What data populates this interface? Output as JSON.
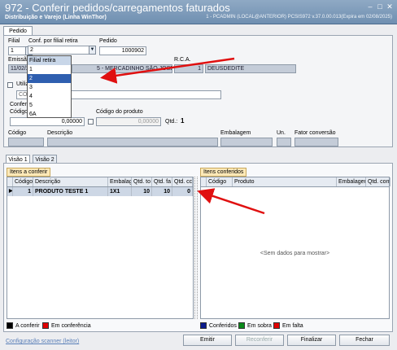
{
  "window": {
    "title": "972 - Conferir pedidos/carregamentos faturados",
    "subtitle": "Distribuição e Varejo (Linha WinThor)",
    "version": "1 - PCADMIN (LOCAL@ANTERIOR)   PCSIS972  v.37.0.00.013(Expira em 02/08/2025)"
  },
  "main_tab": "Pedido",
  "filial": {
    "label": "Filial",
    "value": "1"
  },
  "conf_filial": {
    "label": "Conf. por filial retira",
    "value": "2"
  },
  "pedido": {
    "label": "Pedido",
    "value": "1000902"
  },
  "emissao": {
    "label": "Emissão",
    "value": "11/02/2025"
  },
  "cliente": {
    "value": "5 - MERCADINHO SÃO JOSÉ"
  },
  "rca": {
    "label": "R.C.A.",
    "code": "1",
    "name": "DEUSDEDITE"
  },
  "utiliza": {
    "label": "Utiliza em"
  },
  "codigo_placeholder": "CÓDIGO",
  "conferencia": {
    "label": "Conferência"
  },
  "codigo_b": {
    "label": "Código de b",
    "value": "0,00000"
  },
  "codigo_produto": {
    "label": "Código do produto",
    "value": "0,00000"
  },
  "qtd": {
    "label": "Qtd.:",
    "value": "1"
  },
  "product_headers": {
    "codigo": "Código",
    "descricao": "Descrição",
    "embalagem": "Embalagem",
    "un": "Un.",
    "fator": "Fator conversão"
  },
  "dropdown": {
    "header": "Filial retira",
    "options": [
      "1",
      "2",
      "3",
      "4",
      "5",
      "6A"
    ],
    "selected": "2"
  },
  "visao_tabs": [
    "Visão 1",
    "Visão 2"
  ],
  "itens_conferir": {
    "title": "Itens a conferir",
    "columns": [
      "Código",
      "Descrição",
      "Embalage",
      "Qtd. to",
      "Qtd. fa",
      "Qtd. cc"
    ],
    "rows": [
      {
        "codigo": "1",
        "descricao": "PRODUTO TESTE 1",
        "embalagem": "1X1",
        "qtd_total": "10",
        "qtd_faturada": "10",
        "qtd_conferida": "0"
      }
    ]
  },
  "itens_conferidos": {
    "title": "Itens conferidos",
    "columns": [
      "Código",
      "Produto",
      "Embalagem",
      "Qtd. confi"
    ],
    "empty_text": "<Sem dados para mostrar>"
  },
  "legend_left": [
    {
      "label": "A conferir",
      "color": "#000000"
    },
    {
      "label": "Em conferência",
      "color": "#e00000"
    }
  ],
  "legend_right": [
    {
      "label": "Conferidos",
      "color": "#0b1a8c"
    },
    {
      "label": "Em sobra",
      "color": "#0a8a1a"
    },
    {
      "label": "Em falta",
      "color": "#e00000"
    }
  ],
  "footer": {
    "config_link": "Configuração scanner (leitor)",
    "emitir": "Emitir",
    "reconferir": "Reconferir",
    "finalizar": "Finalizar",
    "fechar": "Fechar"
  }
}
